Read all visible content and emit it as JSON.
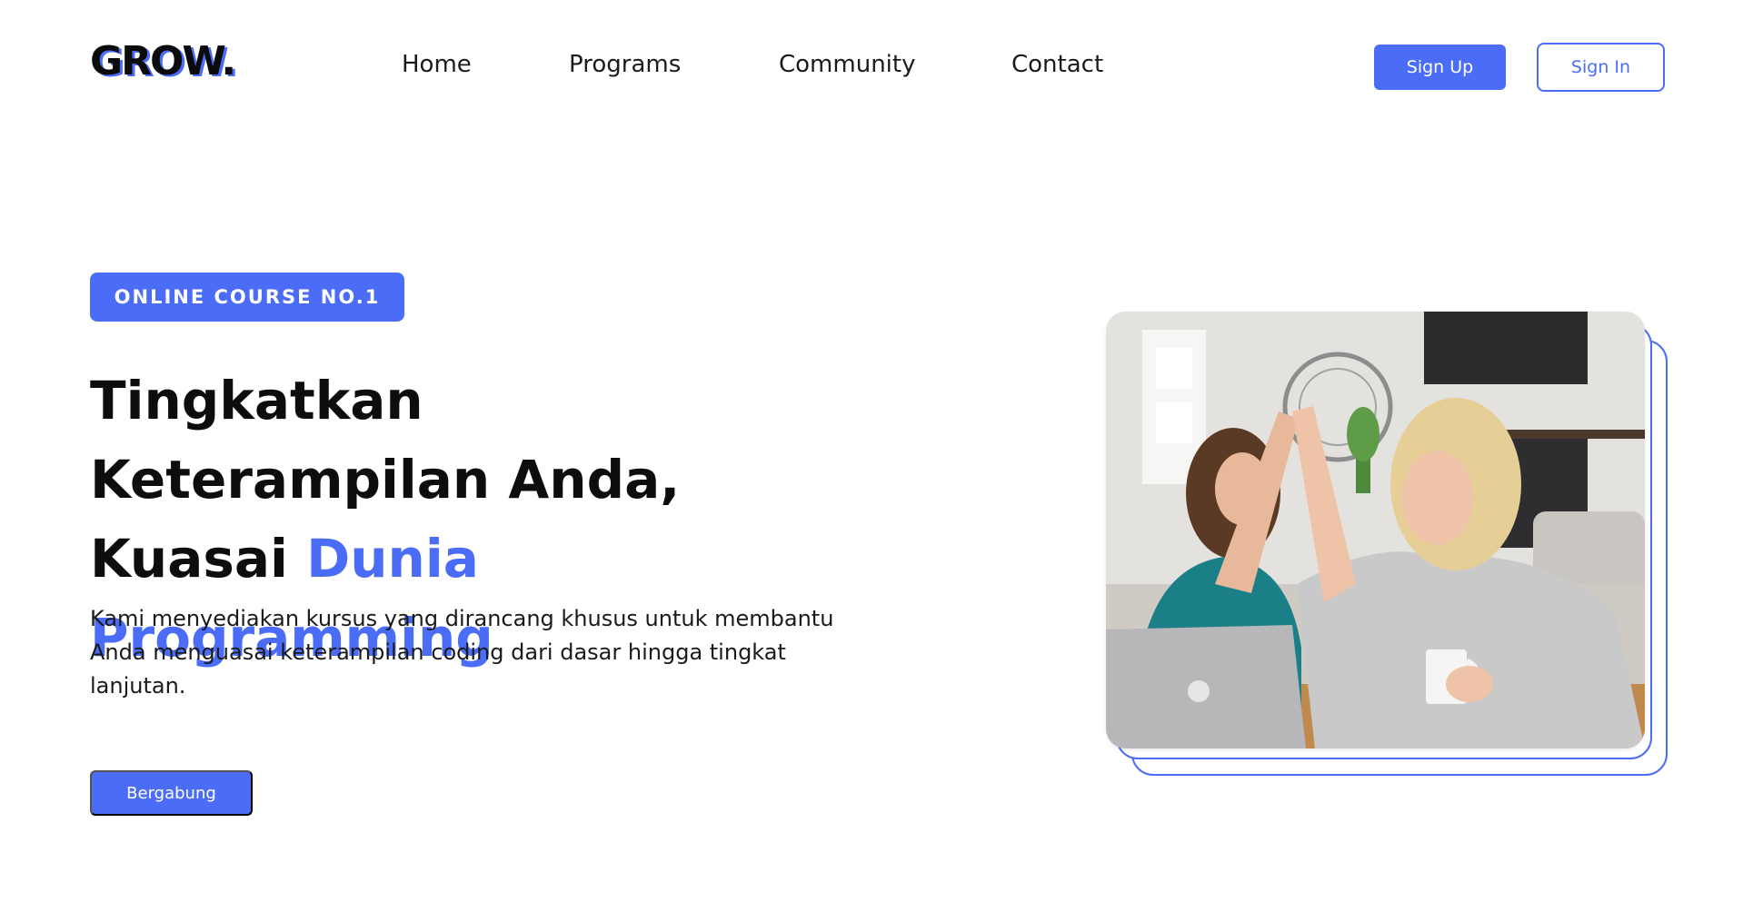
{
  "brand": {
    "logo_text": "GROW."
  },
  "nav": {
    "items": [
      {
        "label": "Home"
      },
      {
        "label": "Programs"
      },
      {
        "label": "Community"
      },
      {
        "label": "Contact"
      }
    ],
    "signup_label": "Sign Up",
    "signin_label": "Sign In"
  },
  "hero": {
    "badge": "ONLINE COURSE NO.1",
    "headline_part1": "Tingkatkan Keterampilan Anda, Kuasai ",
    "headline_accent": "Dunia Programming",
    "description": "Kami menyediakan kursus yang dirancang khusus untuk membantu Anda menguasai keterampilan coding dari dasar hingga tingkat lanjutan.",
    "cta_label": "Bergabung"
  },
  "colors": {
    "accent": "#4a6cf7",
    "text": "#111111",
    "background": "#ffffff"
  }
}
